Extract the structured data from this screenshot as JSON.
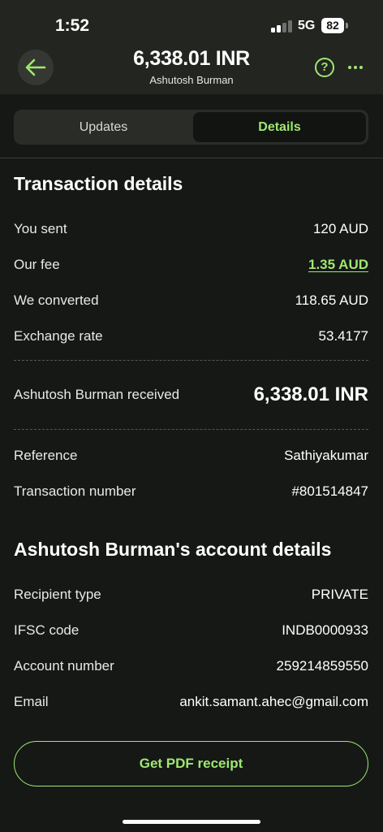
{
  "status_bar": {
    "time": "1:52",
    "network": "5G",
    "battery": "82"
  },
  "header": {
    "amount": "6,338.01 INR",
    "recipient_name": "Ashutosh Burman",
    "help_symbol": "?"
  },
  "tabs": [
    {
      "label": "Updates",
      "active": false
    },
    {
      "label": "Details",
      "active": true
    }
  ],
  "transaction": {
    "title": "Transaction details",
    "rows": [
      {
        "label": "You sent",
        "value": "120 AUD"
      },
      {
        "label": "Our fee",
        "value": "1.35 AUD"
      },
      {
        "label": "We converted",
        "value": "118.65 AUD"
      },
      {
        "label": "Exchange rate",
        "value": "53.4177"
      }
    ],
    "received_label": "Ashutosh Burman received",
    "received_value": "6,338.01 INR",
    "reference_label": "Reference",
    "reference_value": "Sathiyakumar",
    "number_label": "Transaction number",
    "number_value": "#801514847"
  },
  "account": {
    "title": "Ashutosh Burman's account details",
    "rows": [
      {
        "label": "Recipient type",
        "value": "PRIVATE"
      },
      {
        "label": "IFSC code",
        "value": "INDB0000933"
      },
      {
        "label": "Account number",
        "value": "259214859550"
      },
      {
        "label": "Email",
        "value": "ankit.samant.ahec@gmail.com"
      }
    ]
  },
  "actions": {
    "pdf_button": "Get PDF receipt"
  },
  "icons": {
    "back": "arrow-left-icon",
    "help": "question-circle-icon",
    "more": "more-horizontal-icon",
    "signal": "cellular-signal-icon",
    "battery": "battery-icon"
  },
  "colors": {
    "accent": "#9fe870",
    "background": "#161816",
    "header_background": "#232521"
  }
}
